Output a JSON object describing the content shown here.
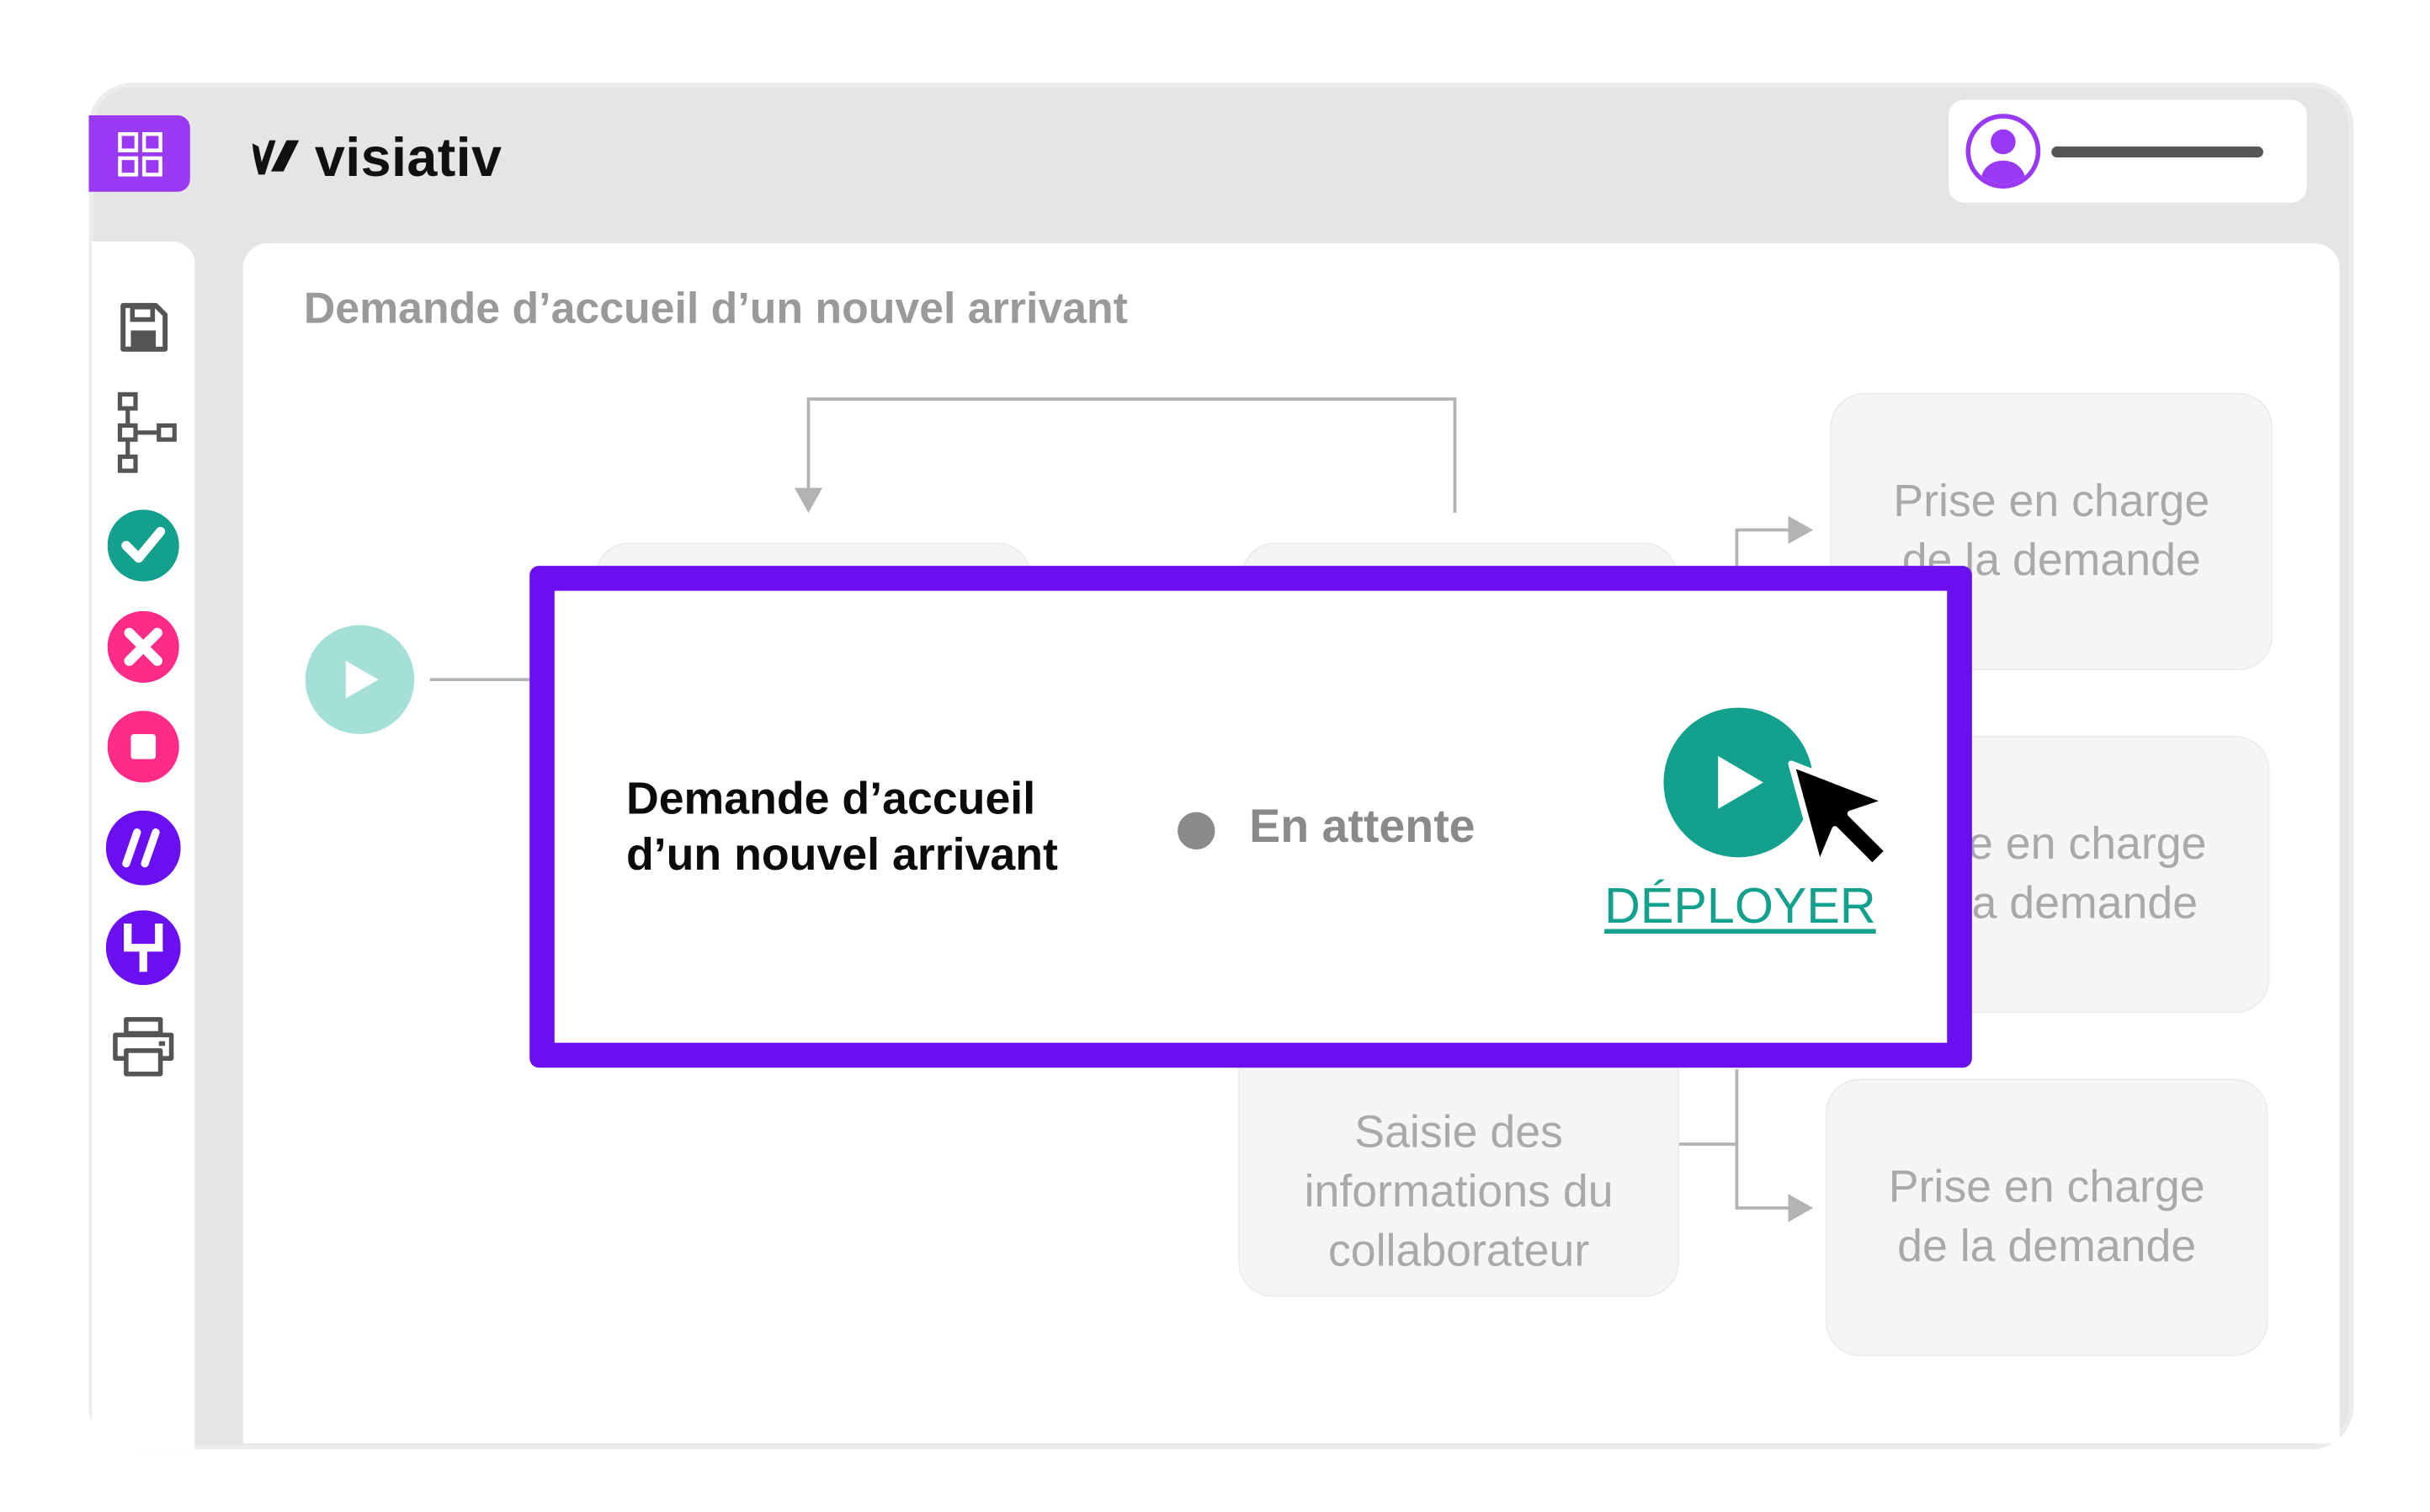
{
  "header": {
    "brand": "visiativ",
    "apps_icon": "grid-icon",
    "user_avatar_icon": "user-avatar-icon"
  },
  "sidebar": {
    "tools": [
      {
        "icon": "save-icon",
        "color": "#555555"
      },
      {
        "icon": "workflow-tree-icon",
        "color": "#555555"
      },
      {
        "icon": "check-icon",
        "color": "#13a08c"
      },
      {
        "icon": "close-icon",
        "color": "#ff2b88"
      },
      {
        "icon": "stop-icon",
        "color": "#ff2b88"
      },
      {
        "icon": "slashes-icon",
        "color": "#6a10f0"
      },
      {
        "icon": "fork-icon",
        "color": "#6a10f0"
      },
      {
        "icon": "print-icon",
        "color": "#555555"
      }
    ]
  },
  "page": {
    "title": "Demande d’accueil d’un nouvel arrivant"
  },
  "workflow": {
    "nodes": {
      "top_right": "Prise en charge de la demande",
      "middle_right": "Prise en charge de la demande",
      "bottom_center": "Saisie des informations du collaborateur",
      "bottom_right": "Prise en charge de la demande"
    }
  },
  "modal": {
    "title_line1": "Demande d’accueil",
    "title_line2": "d’un nouvel arrivant",
    "status": "En attente",
    "deploy_label": "DÉPLOYER"
  },
  "colors": {
    "accent_purple": "#6a10f0",
    "apps_purple": "#9a39f3",
    "teal": "#13a08c",
    "teal_light": "#a5e0d7",
    "pink": "#ff2b88"
  }
}
